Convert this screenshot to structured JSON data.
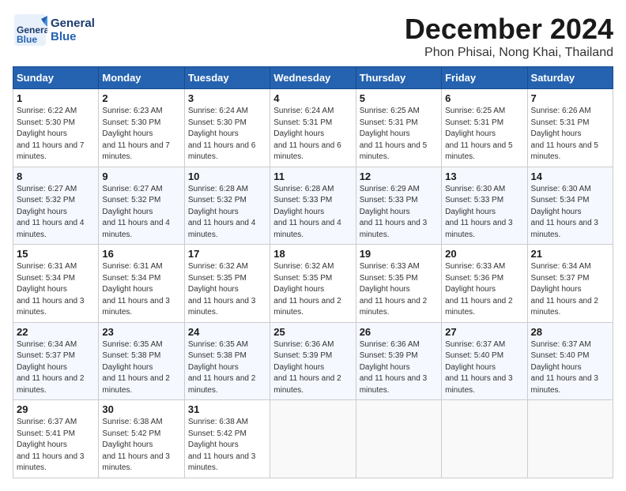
{
  "header": {
    "logo_line1": "General",
    "logo_line2": "Blue",
    "title": "December 2024",
    "subtitle": "Phon Phisai, Nong Khai, Thailand"
  },
  "days_of_week": [
    "Sunday",
    "Monday",
    "Tuesday",
    "Wednesday",
    "Thursday",
    "Friday",
    "Saturday"
  ],
  "weeks": [
    [
      {
        "day": "1",
        "sunrise": "6:22 AM",
        "sunset": "5:30 PM",
        "daylight": "11 hours and 7 minutes."
      },
      {
        "day": "2",
        "sunrise": "6:23 AM",
        "sunset": "5:30 PM",
        "daylight": "11 hours and 7 minutes."
      },
      {
        "day": "3",
        "sunrise": "6:24 AM",
        "sunset": "5:30 PM",
        "daylight": "11 hours and 6 minutes."
      },
      {
        "day": "4",
        "sunrise": "6:24 AM",
        "sunset": "5:31 PM",
        "daylight": "11 hours and 6 minutes."
      },
      {
        "day": "5",
        "sunrise": "6:25 AM",
        "sunset": "5:31 PM",
        "daylight": "11 hours and 5 minutes."
      },
      {
        "day": "6",
        "sunrise": "6:25 AM",
        "sunset": "5:31 PM",
        "daylight": "11 hours and 5 minutes."
      },
      {
        "day": "7",
        "sunrise": "6:26 AM",
        "sunset": "5:31 PM",
        "daylight": "11 hours and 5 minutes."
      }
    ],
    [
      {
        "day": "8",
        "sunrise": "6:27 AM",
        "sunset": "5:32 PM",
        "daylight": "11 hours and 4 minutes."
      },
      {
        "day": "9",
        "sunrise": "6:27 AM",
        "sunset": "5:32 PM",
        "daylight": "11 hours and 4 minutes."
      },
      {
        "day": "10",
        "sunrise": "6:28 AM",
        "sunset": "5:32 PM",
        "daylight": "11 hours and 4 minutes."
      },
      {
        "day": "11",
        "sunrise": "6:28 AM",
        "sunset": "5:33 PM",
        "daylight": "11 hours and 4 minutes."
      },
      {
        "day": "12",
        "sunrise": "6:29 AM",
        "sunset": "5:33 PM",
        "daylight": "11 hours and 3 minutes."
      },
      {
        "day": "13",
        "sunrise": "6:30 AM",
        "sunset": "5:33 PM",
        "daylight": "11 hours and 3 minutes."
      },
      {
        "day": "14",
        "sunrise": "6:30 AM",
        "sunset": "5:34 PM",
        "daylight": "11 hours and 3 minutes."
      }
    ],
    [
      {
        "day": "15",
        "sunrise": "6:31 AM",
        "sunset": "5:34 PM",
        "daylight": "11 hours and 3 minutes."
      },
      {
        "day": "16",
        "sunrise": "6:31 AM",
        "sunset": "5:34 PM",
        "daylight": "11 hours and 3 minutes."
      },
      {
        "day": "17",
        "sunrise": "6:32 AM",
        "sunset": "5:35 PM",
        "daylight": "11 hours and 3 minutes."
      },
      {
        "day": "18",
        "sunrise": "6:32 AM",
        "sunset": "5:35 PM",
        "daylight": "11 hours and 2 minutes."
      },
      {
        "day": "19",
        "sunrise": "6:33 AM",
        "sunset": "5:35 PM",
        "daylight": "11 hours and 2 minutes."
      },
      {
        "day": "20",
        "sunrise": "6:33 AM",
        "sunset": "5:36 PM",
        "daylight": "11 hours and 2 minutes."
      },
      {
        "day": "21",
        "sunrise": "6:34 AM",
        "sunset": "5:37 PM",
        "daylight": "11 hours and 2 minutes."
      }
    ],
    [
      {
        "day": "22",
        "sunrise": "6:34 AM",
        "sunset": "5:37 PM",
        "daylight": "11 hours and 2 minutes."
      },
      {
        "day": "23",
        "sunrise": "6:35 AM",
        "sunset": "5:38 PM",
        "daylight": "11 hours and 2 minutes."
      },
      {
        "day": "24",
        "sunrise": "6:35 AM",
        "sunset": "5:38 PM",
        "daylight": "11 hours and 2 minutes."
      },
      {
        "day": "25",
        "sunrise": "6:36 AM",
        "sunset": "5:39 PM",
        "daylight": "11 hours and 2 minutes."
      },
      {
        "day": "26",
        "sunrise": "6:36 AM",
        "sunset": "5:39 PM",
        "daylight": "11 hours and 3 minutes."
      },
      {
        "day": "27",
        "sunrise": "6:37 AM",
        "sunset": "5:40 PM",
        "daylight": "11 hours and 3 minutes."
      },
      {
        "day": "28",
        "sunrise": "6:37 AM",
        "sunset": "5:40 PM",
        "daylight": "11 hours and 3 minutes."
      }
    ],
    [
      {
        "day": "29",
        "sunrise": "6:37 AM",
        "sunset": "5:41 PM",
        "daylight": "11 hours and 3 minutes."
      },
      {
        "day": "30",
        "sunrise": "6:38 AM",
        "sunset": "5:42 PM",
        "daylight": "11 hours and 3 minutes."
      },
      {
        "day": "31",
        "sunrise": "6:38 AM",
        "sunset": "5:42 PM",
        "daylight": "11 hours and 3 minutes."
      },
      null,
      null,
      null,
      null
    ]
  ]
}
